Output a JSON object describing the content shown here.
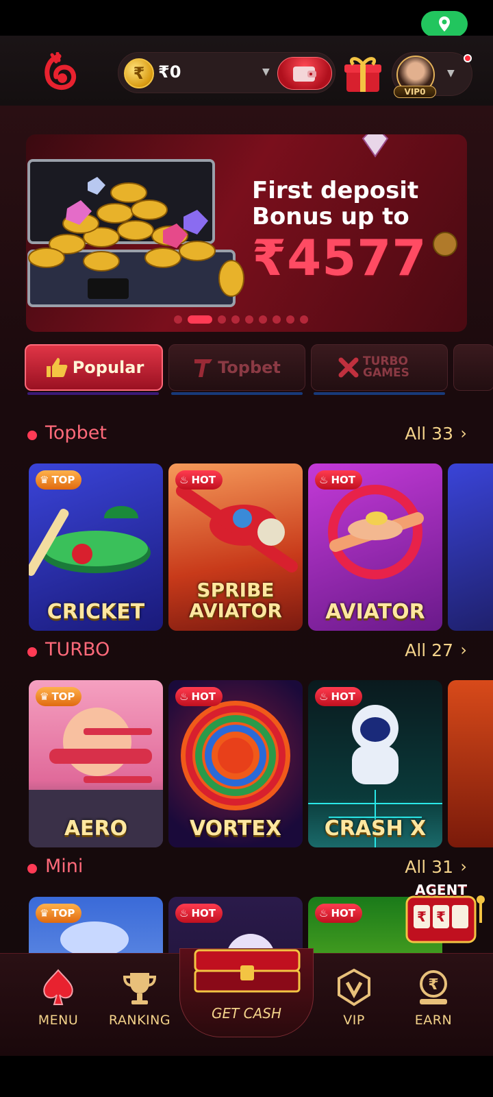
{
  "header": {
    "currency_symbol": "₹",
    "balance": "₹0",
    "vip_level": "VIP0"
  },
  "banner": {
    "line1": "First deposit",
    "line2": "Bonus up to",
    "amount": "₹4577",
    "slide_count": 9,
    "active_slide": 1
  },
  "tabs": [
    {
      "label": "Popular",
      "active": true
    },
    {
      "label": "Topbet",
      "active": false
    },
    {
      "label": "TURBO GAMES",
      "active": false
    }
  ],
  "sections": [
    {
      "title": "Topbet",
      "all_label": "All 33",
      "cards": [
        {
          "title": "CRICKET",
          "badge": "TOP"
        },
        {
          "title_line1": "SPRIBE",
          "title_line2": "AVIATOR",
          "badge": "HOT"
        },
        {
          "title": "AVIATOR",
          "badge": "HOT"
        }
      ]
    },
    {
      "title": "TURBO",
      "all_label": "All 27",
      "cards": [
        {
          "title": "AERO",
          "badge": "TOP"
        },
        {
          "title": "VORTEX",
          "badge": "HOT"
        },
        {
          "title": "CRASH X",
          "badge": "HOT"
        }
      ]
    },
    {
      "title": "Mini",
      "all_label": "All 31",
      "cards": [
        {
          "badge": "TOP"
        },
        {
          "badge": "HOT"
        },
        {
          "badge": "HOT"
        }
      ]
    }
  ],
  "agent_label": "AGENT",
  "nav": {
    "menu": "MENU",
    "ranking": "RANKING",
    "get_cash": "GET CASH",
    "vip": "VIP",
    "earn": "EARN"
  },
  "colors": {
    "accent": "#ff3b55",
    "gold": "#f3d28a",
    "background": "#1a0a0d"
  }
}
